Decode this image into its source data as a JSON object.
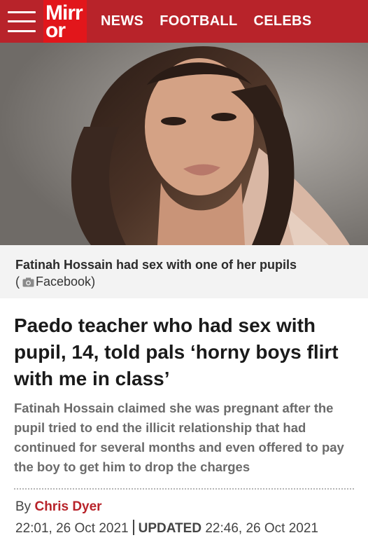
{
  "header": {
    "logo_line1": "Mirr",
    "logo_line2": "or",
    "nav": [
      "NEWS",
      "FOOTBALL",
      "CELEBS"
    ]
  },
  "image": {
    "caption": "Fatinah Hossain had sex with one of her pupils",
    "credit_open": "(",
    "credit_source": "Facebook",
    "credit_close": ")"
  },
  "article": {
    "headline": "Paedo teacher who had sex with pupil, 14, told pals ‘horny boys flirt with me in class’",
    "standfirst": "Fatinah Hossain claimed she was pregnant after the pupil tried to end the illicit relationship that had continued for several months and even offered to pay the boy to get him to drop the charges",
    "by_label": "By",
    "author": "Chris Dyer",
    "published": "22:01, 26 Oct 2021",
    "updated_label": "UPDATED",
    "updated": "22:46, 26 Oct 2021"
  },
  "colors": {
    "header_bg": "#b8232a",
    "logo_bg": "#e2161b",
    "author": "#b8232a"
  }
}
